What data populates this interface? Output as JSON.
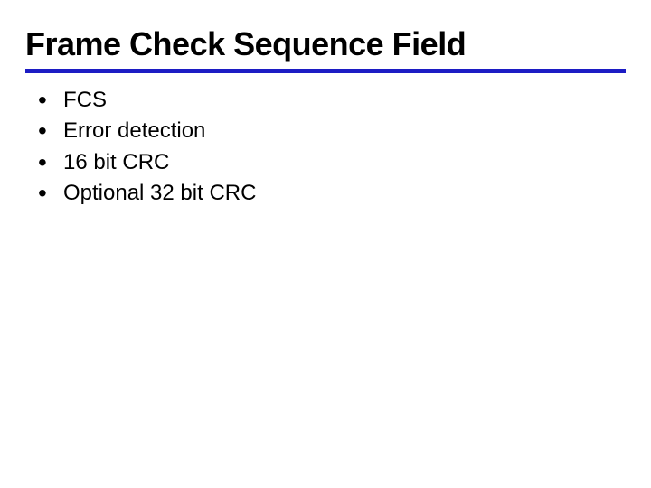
{
  "slide": {
    "title": "Frame Check Sequence Field",
    "bullets": [
      "FCS",
      "Error detection",
      "16 bit CRC",
      "Optional 32 bit CRC"
    ]
  }
}
